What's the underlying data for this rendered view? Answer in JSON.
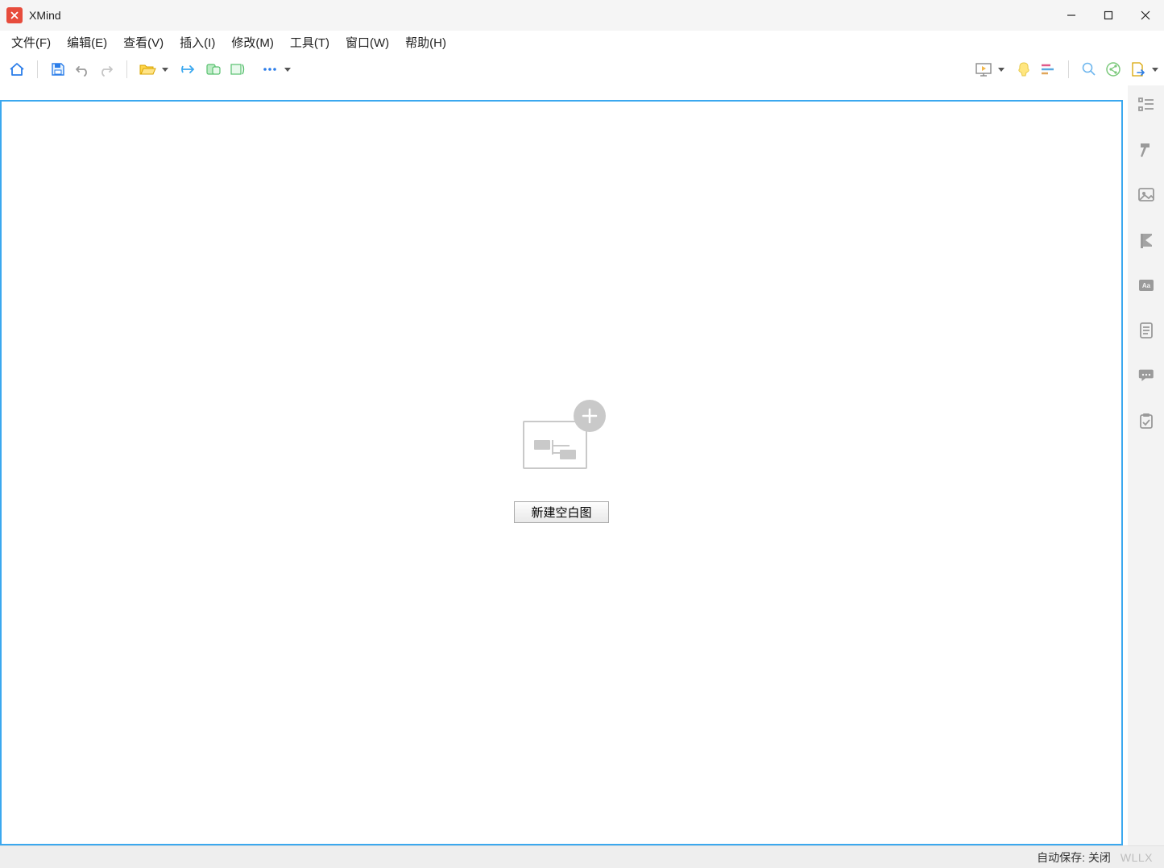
{
  "app": {
    "title": "XMind"
  },
  "menus": {
    "file": "文件(F)",
    "edit": "编辑(E)",
    "view": "查看(V)",
    "insert": "插入(I)",
    "modify": "修改(M)",
    "tools": "工具(T)",
    "window": "窗口(W)",
    "help": "帮助(H)"
  },
  "canvas": {
    "new_button": "新建空白图"
  },
  "status": {
    "autosave": "自动保存: 关闭",
    "watermark": "WLLX"
  }
}
